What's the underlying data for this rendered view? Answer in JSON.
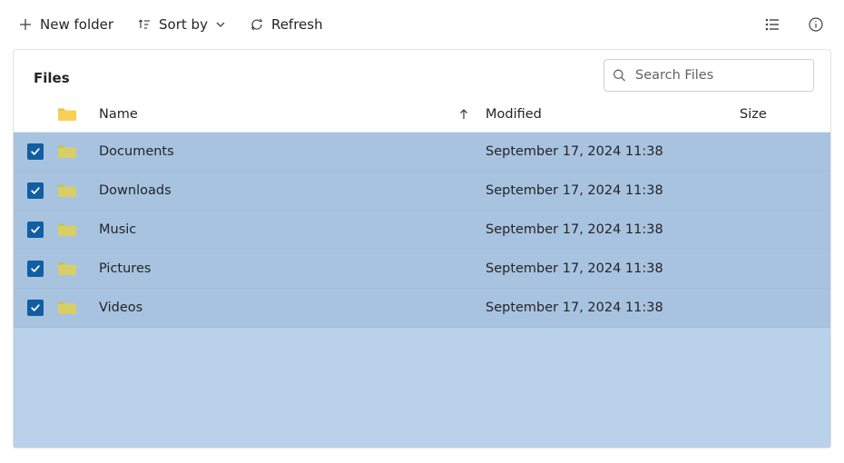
{
  "toolbar": {
    "new_folder_label": "New folder",
    "sort_by_label": "Sort by",
    "refresh_label": "Refresh"
  },
  "panel": {
    "title": "Files"
  },
  "search": {
    "placeholder": "Search Files"
  },
  "columns": {
    "name": "Name",
    "modified": "Modified",
    "size": "Size",
    "sort_column": "name",
    "sort_dir": "asc"
  },
  "rows": [
    {
      "name": "Documents",
      "modified": "September 17, 2024 11:38",
      "size": "",
      "selected": true
    },
    {
      "name": "Downloads",
      "modified": "September 17, 2024 11:38",
      "size": "",
      "selected": true
    },
    {
      "name": "Music",
      "modified": "September 17, 2024 11:38",
      "size": "",
      "selected": true
    },
    {
      "name": "Pictures",
      "modified": "September 17, 2024 11:38",
      "size": "",
      "selected": true
    },
    {
      "name": "Videos",
      "modified": "September 17, 2024 11:38",
      "size": "",
      "selected": true
    }
  ],
  "colors": {
    "selection_bg": "#a8c3e0",
    "selection_region_bg": "#b9d1ea",
    "checkbox": "#115ea3",
    "folder_header_icon": "#f7d154",
    "folder_row_icon": "#d7cf66"
  }
}
